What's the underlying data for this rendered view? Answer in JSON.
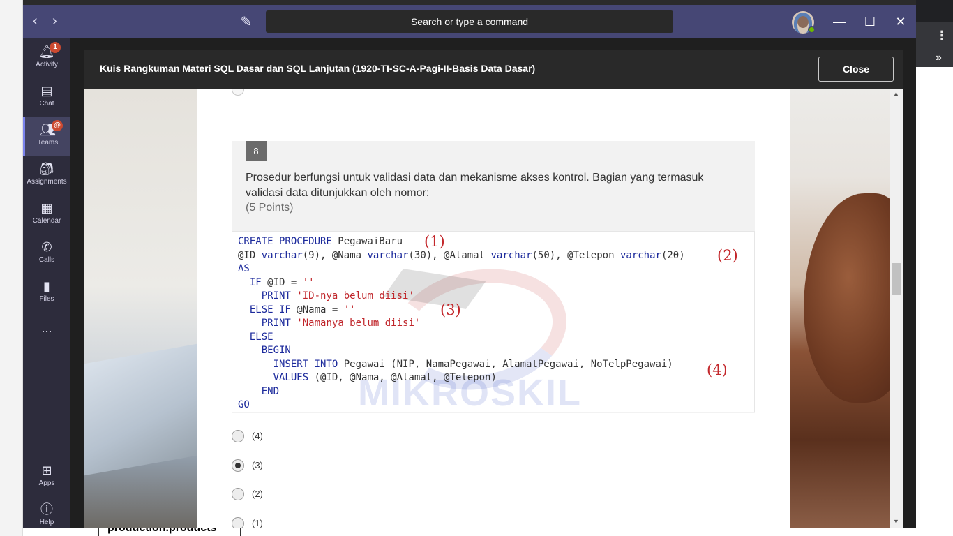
{
  "window": {
    "search_placeholder": "Search or type a command",
    "back_icon": "chevron-left-icon",
    "forward_icon": "chevron-right-icon",
    "compose_icon": "compose-icon"
  },
  "rail": {
    "items": [
      {
        "label": "Activity",
        "icon": "bell-icon",
        "badge": "1"
      },
      {
        "label": "Chat",
        "icon": "chat-icon"
      },
      {
        "label": "Teams",
        "icon": "teams-icon",
        "badge": "@"
      },
      {
        "label": "Assignments",
        "icon": "backpack-icon"
      },
      {
        "label": "Calendar",
        "icon": "calendar-icon"
      },
      {
        "label": "Calls",
        "icon": "phone-icon"
      },
      {
        "label": "Files",
        "icon": "file-icon"
      },
      {
        "label": "...",
        "icon": "more-icon"
      }
    ],
    "bottom": [
      {
        "label": "Apps",
        "icon": "apps-icon"
      },
      {
        "label": "Help",
        "icon": "help-icon"
      }
    ]
  },
  "modal": {
    "title": "Kuis Rangkuman Materi SQL Dasar dan SQL Lanjutan (1920-TI-SC-A-Pagi-II-Basis Data Dasar)",
    "close_label": "Close"
  },
  "question": {
    "number": "8",
    "text": "Prosedur berfungsi untuk validasi data dan mekanisme akses kontrol. Bagian yang termasuk validasi data ditunjukkan oleh nomor:",
    "points": "(5 Points)",
    "code_lines": [
      "CREATE PROCEDURE PegawaiBaru",
      "@ID varchar(9), @Nama varchar(30), @Alamat varchar(50), @Telepon varchar(20)",
      "AS",
      "  IF @ID = ''",
      "    PRINT 'ID-nya belum diisi'",
      "  ELSE IF @Nama = ''",
      "    PRINT 'Namanya belum diisi'",
      "  ELSE",
      "    BEGIN",
      "      INSERT INTO Pegawai (NIP, NamaPegawai, AlamatPegawai, NoTelpPegawai)",
      "      VALUES (@ID, @Nama, @Alamat, @Telepon)",
      "    END",
      "GO"
    ],
    "annotations": [
      "(1)",
      "(2)",
      "(3)",
      "(4)"
    ],
    "watermark": "MIKROSKIL",
    "options": [
      {
        "label": "(4)",
        "selected": false
      },
      {
        "label": "(3)",
        "selected": true
      },
      {
        "label": "(2)",
        "selected": false
      },
      {
        "label": "(1)",
        "selected": false
      }
    ]
  },
  "background": {
    "bottom_tab": "production.products"
  },
  "colors": {
    "titlebar": "#464775",
    "rail": "#2d2c3c",
    "modal_header": "#292929",
    "keyword": "#1c2a9c",
    "string": "#c0262b",
    "annotation": "#c3272b"
  }
}
